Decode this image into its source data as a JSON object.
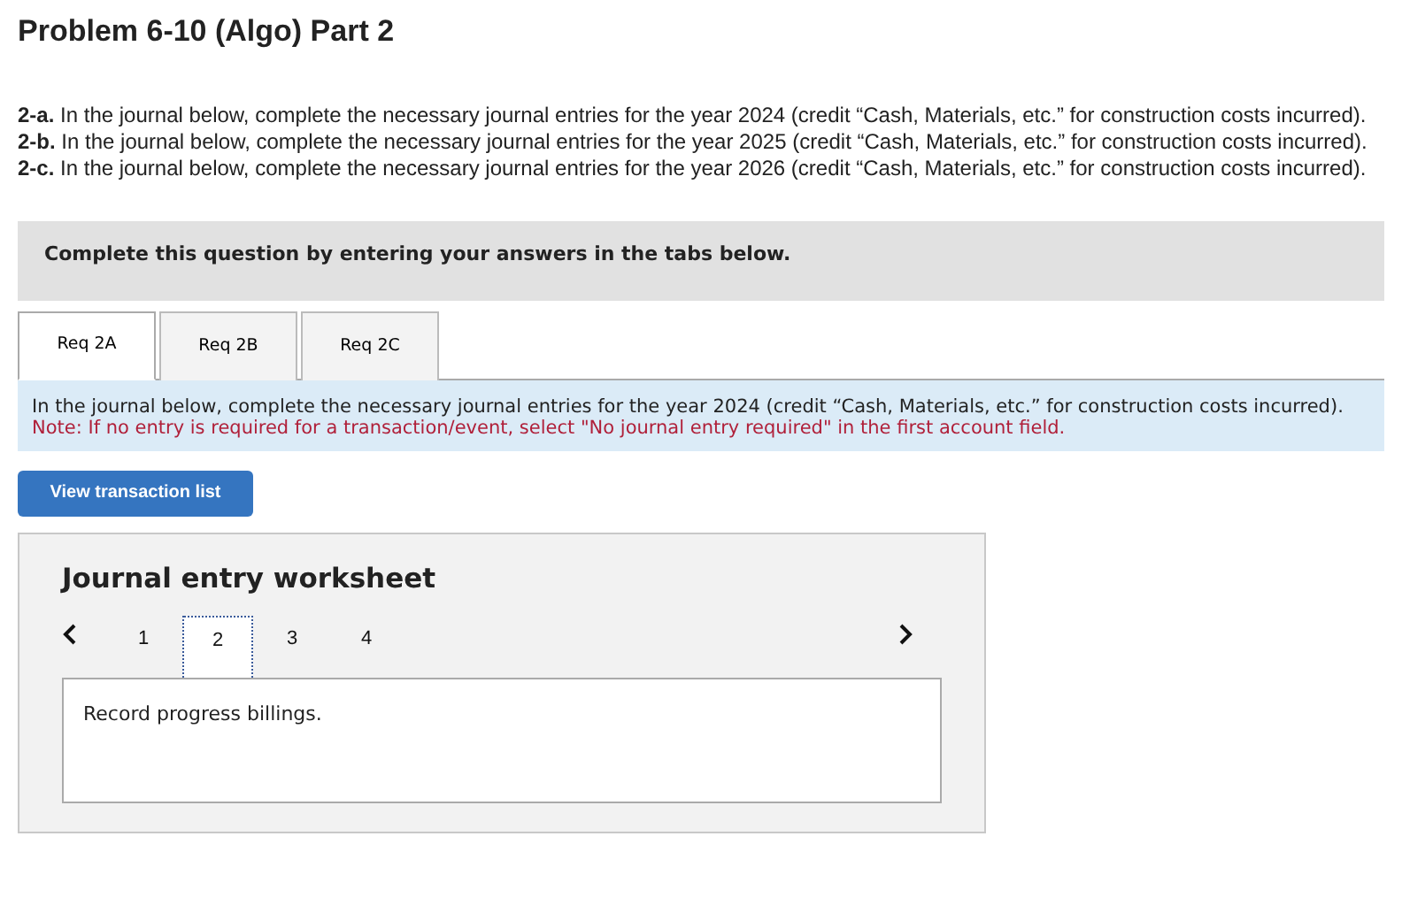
{
  "title": "Problem 6-10 (Algo) Part 2",
  "requirements": [
    "**2-a.** In the journal below, complete the necessary journal entries for the year 2024 (credit “Cash, Materials, etc.” for construction costs incurred).",
    "**2-b.** In the journal below, complete the necessary journal entries for the year 2025 (credit “Cash, Materials, etc.” for construction costs incurred).",
    "**2-c.** In the journal below, complete the necessary journal entries for the year 2026 (credit “Cash, Materials, etc.” for construction costs incurred)."
  ],
  "instruction_banner": "Complete this question by entering your answers in the tabs below.",
  "tabs": [
    {
      "label": "Req 2A",
      "selected": true
    },
    {
      "label": "Req 2B",
      "selected": false
    },
    {
      "label": "Req 2C",
      "selected": false
    }
  ],
  "tab_panel": {
    "instruction": "In the journal below, complete the necessary journal entries for the year 2024 (credit “Cash, Materials, etc.” for construction costs incurred).",
    "note": "Note: If no entry is required for a transaction/event, select \"No journal entry required\" in the first account field."
  },
  "view_button": "View transaction list",
  "worksheet": {
    "title": "Journal entry worksheet",
    "pages": [
      {
        "label": "1",
        "selected": false
      },
      {
        "label": "2",
        "selected": true
      },
      {
        "label": "3",
        "selected": false
      },
      {
        "label": "4",
        "selected": false
      }
    ],
    "description": "Record progress billings."
  }
}
